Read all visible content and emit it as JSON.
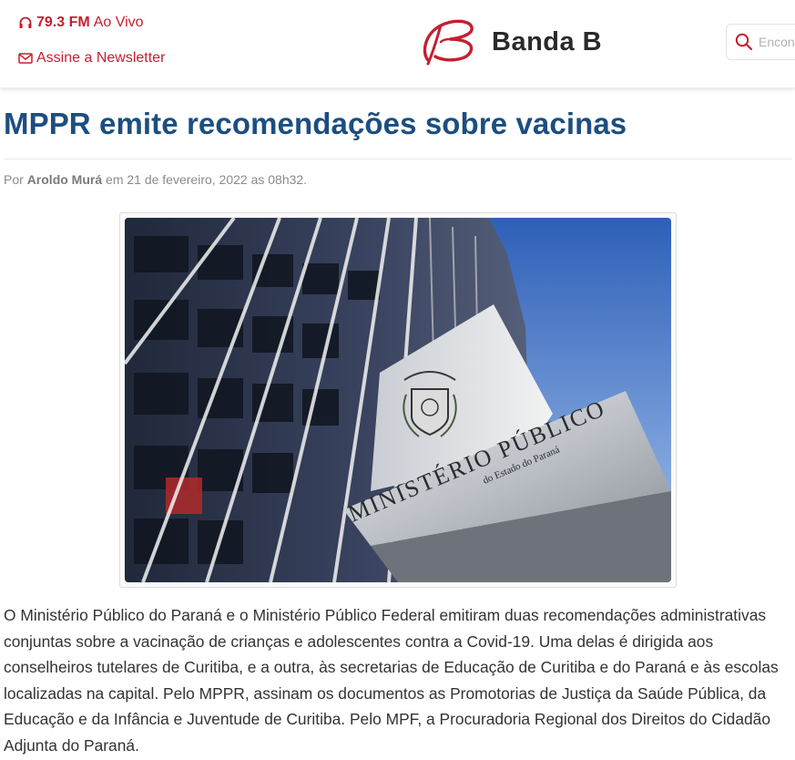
{
  "header": {
    "radio": {
      "icon": "headphones-icon",
      "frequency": "79.3 FM",
      "status": "Ao Vivo"
    },
    "newsletter": {
      "icon": "envelope-icon",
      "label": "Assine a Newsletter"
    },
    "logo": {
      "icon": "banda-b-swoosh-logo",
      "text": "Banda B"
    },
    "search": {
      "icon": "search-icon",
      "placeholder": "Encontre"
    }
  },
  "article": {
    "title": "MPPR emite recomendações sobre vacinas",
    "byline": {
      "prefix": "Por",
      "author": "Aroldo Murá",
      "date_text": "em 21 de fevereiro, 2022 as 08h32."
    },
    "image": {
      "sign_line1": "MINISTÉRIO PÚBLICO",
      "sign_line2": "do Estado do Paraná"
    },
    "body": "O Ministério Público do Paraná e o Ministério Público Federal emitiram duas recomendações administrativas conjuntas sobre a vacinação de crianças e adolescentes contra a Covid-19. Uma delas é dirigida aos conselheiros tutelares de Curitiba, e a outra, às secretarias de Educação de Curitiba e do Paraná e às escolas localizadas na capital. Pelo MPPR, assinam os documentos as Promotorias de Justiça da Saúde Pública, da Educação e da Infância e Juventude de Curitiba. Pelo MPF, a Procuradoria Regional dos Direitos do Cidadão Adjunta do Paraná."
  },
  "colors": {
    "brand_red": "#c4202f",
    "headline_blue": "#1c4e80",
    "body_text": "#333333",
    "meta_gray": "#8a8a8a"
  }
}
